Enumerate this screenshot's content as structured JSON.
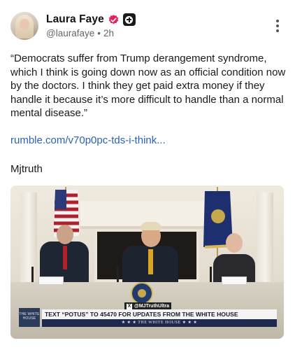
{
  "author": {
    "display_name": "Laura Faye",
    "handle": "@laurafaye",
    "separator": "•",
    "time": "2h",
    "badges": [
      "verified-badge-icon",
      "plus-badge-icon"
    ],
    "verified_color": "#e0245e"
  },
  "post": {
    "text": "“Democrats suffer from Trump derangement syndrome, which I think is going down now as an official condition now by the doctors. I think they get paid extra money if they handle it because it’s more difficult to handle than a normal mental disease.”",
    "link": "rumble.com/v70p0pc-tds-i-think...",
    "link_color": "#2a62b5",
    "tag": "Mjtruth"
  },
  "media": {
    "watermark": "@MJTruthUltra",
    "logo_text": "THE WHITE HOUSE",
    "ticker": "TEXT “POTUS” TO 45470 FOR UPDATES FROM THE WHITE HOUSE",
    "subticker": "★ ★ ★  THE WHITE HOUSE  ★ ★ ★"
  }
}
